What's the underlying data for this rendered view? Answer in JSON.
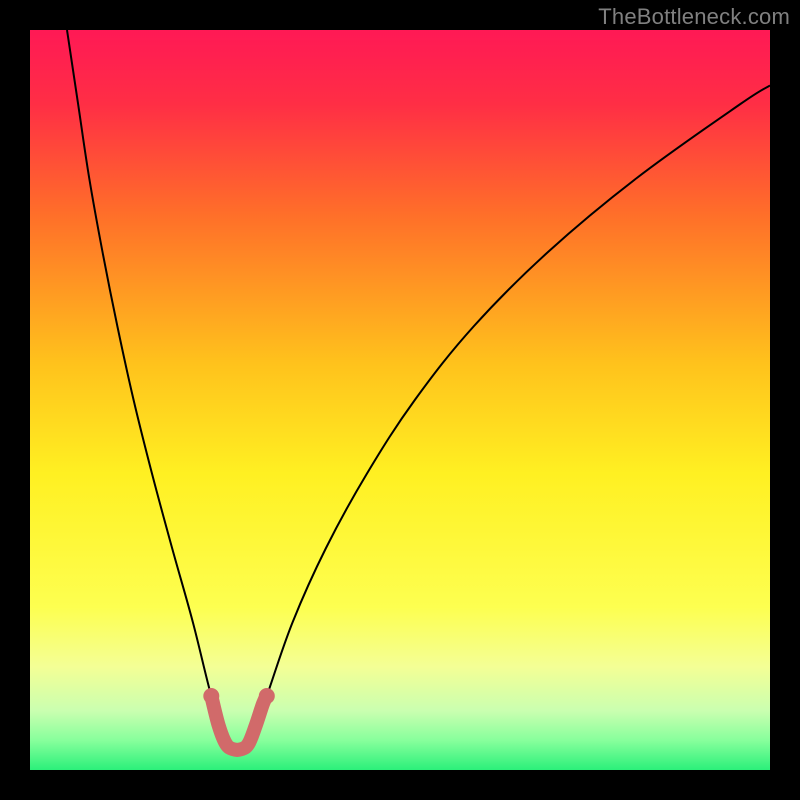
{
  "watermark": "TheBottleneck.com",
  "chart_data": {
    "type": "line",
    "title": "",
    "xlabel": "",
    "ylabel": "",
    "xlim": [
      0,
      100
    ],
    "ylim": [
      0,
      100
    ],
    "background_gradient": {
      "stops": [
        {
          "offset": 0.0,
          "color": "#ff1955"
        },
        {
          "offset": 0.1,
          "color": "#ff2e45"
        },
        {
          "offset": 0.25,
          "color": "#ff6f29"
        },
        {
          "offset": 0.45,
          "color": "#ffc21c"
        },
        {
          "offset": 0.6,
          "color": "#fff022"
        },
        {
          "offset": 0.78,
          "color": "#fdff50"
        },
        {
          "offset": 0.86,
          "color": "#f4ff95"
        },
        {
          "offset": 0.92,
          "color": "#caffb0"
        },
        {
          "offset": 0.96,
          "color": "#87ff9c"
        },
        {
          "offset": 1.0,
          "color": "#2bf07a"
        }
      ]
    },
    "series": [
      {
        "name": "bottleneck-curve",
        "stroke": "#000000",
        "points": [
          {
            "x": 5.0,
            "y": 100.0
          },
          {
            "x": 6.5,
            "y": 90.0
          },
          {
            "x": 8.0,
            "y": 80.0
          },
          {
            "x": 9.8,
            "y": 70.0
          },
          {
            "x": 11.8,
            "y": 60.0
          },
          {
            "x": 14.0,
            "y": 50.0
          },
          {
            "x": 16.5,
            "y": 40.0
          },
          {
            "x": 19.2,
            "y": 30.0
          },
          {
            "x": 22.0,
            "y": 20.0
          },
          {
            "x": 24.5,
            "y": 10.0
          },
          {
            "x": 26.2,
            "y": 5.0
          },
          {
            "x": 27.5,
            "y": 2.5
          },
          {
            "x": 29.0,
            "y": 2.5
          },
          {
            "x": 30.2,
            "y": 5.0
          },
          {
            "x": 32.0,
            "y": 10.0
          },
          {
            "x": 35.5,
            "y": 20.0
          },
          {
            "x": 40.0,
            "y": 30.0
          },
          {
            "x": 45.5,
            "y": 40.0
          },
          {
            "x": 52.0,
            "y": 50.0
          },
          {
            "x": 60.0,
            "y": 60.0
          },
          {
            "x": 70.0,
            "y": 70.0
          },
          {
            "x": 82.0,
            "y": 80.0
          },
          {
            "x": 96.0,
            "y": 90.0
          },
          {
            "x": 100.0,
            "y": 92.5
          }
        ]
      },
      {
        "name": "optimal-highlight",
        "stroke": "#d16a6a",
        "points": [
          {
            "x": 24.5,
            "y": 10.0
          },
          {
            "x": 25.5,
            "y": 6.0
          },
          {
            "x": 26.5,
            "y": 3.5
          },
          {
            "x": 27.5,
            "y": 2.8
          },
          {
            "x": 28.5,
            "y": 2.8
          },
          {
            "x": 29.5,
            "y": 3.5
          },
          {
            "x": 30.5,
            "y": 6.0
          },
          {
            "x": 31.5,
            "y": 9.0
          },
          {
            "x": 32.0,
            "y": 10.0
          }
        ]
      }
    ]
  }
}
